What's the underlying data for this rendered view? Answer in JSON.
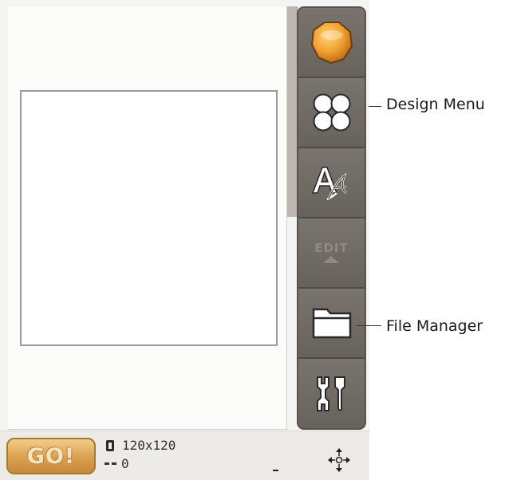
{
  "status_bar": {
    "go_label": "GO!",
    "hoop_size": "120x120",
    "stitch_count": "0"
  },
  "toolbar": {
    "edit_label": "EDIT",
    "buttons": [
      "home-icon",
      "design-menu-icon",
      "text-icon",
      "edit-icon",
      "folder-icon",
      "tools-icon"
    ]
  },
  "callouts": {
    "design_menu": "Design Menu",
    "file_manager": "File Manager"
  },
  "colors": {
    "toolbar": "#6e6862",
    "go_button": "#d9a050",
    "home_orb": "#e39a25"
  }
}
